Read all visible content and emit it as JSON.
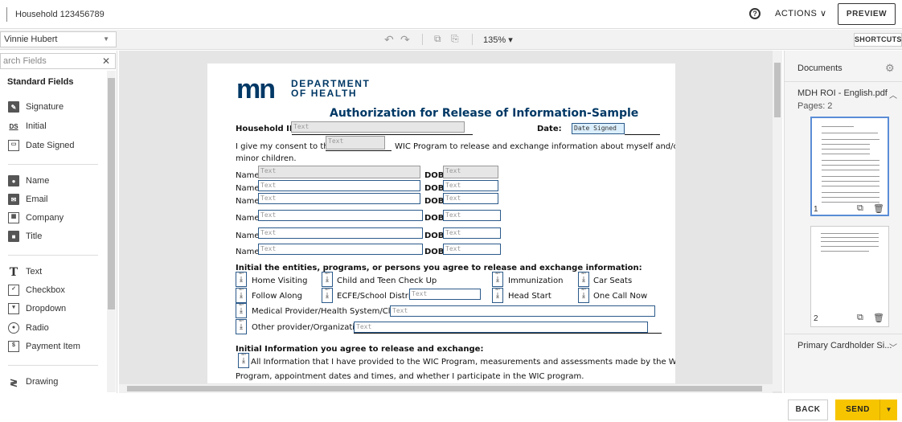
{
  "header": {
    "doc_title": "Household 123456789",
    "help_icon": "?",
    "actions_label": "ACTIONS ∨",
    "preview_label": "PREVIEW"
  },
  "toolbar": {
    "signer": "Vinnie Hubert",
    "zoom": "135% ▾",
    "shortcuts_label": "SHORTCUTS"
  },
  "sidebar": {
    "search_placeholder": "arch Fields",
    "section_title": "Standard Fields",
    "fields": [
      {
        "label": "Signature",
        "icon": "signature-icon"
      },
      {
        "label": "Initial",
        "icon": "initial-icon",
        "glyph": "DS"
      },
      {
        "label": "Date Signed",
        "icon": "calendar-icon"
      },
      {
        "label": "Name",
        "icon": "person-icon"
      },
      {
        "label": "Email",
        "icon": "envelope-icon"
      },
      {
        "label": "Company",
        "icon": "building-icon"
      },
      {
        "label": "Title",
        "icon": "briefcase-icon"
      },
      {
        "label": "Text",
        "icon": "text-icon",
        "glyph": "T"
      },
      {
        "label": "Checkbox",
        "icon": "checkbox-icon"
      },
      {
        "label": "Dropdown",
        "icon": "dropdown-icon"
      },
      {
        "label": "Radio",
        "icon": "radio-icon"
      },
      {
        "label": "Payment Item",
        "icon": "payment-icon"
      },
      {
        "label": "Drawing",
        "icon": "drawing-icon"
      }
    ]
  },
  "document": {
    "logo_text": "mn",
    "dept_line1": "DEPARTMENT",
    "dept_line2": "OF HEALTH",
    "title": "Authorization for Release of Information-Sample",
    "household_label": "Household ID#",
    "date_label": "Date:",
    "date_field": "Date Signed",
    "field_placeholder": "Text",
    "consent_a": "I give my consent to the",
    "consent_b": "WIC Program to release and exchange information about myself and/or my",
    "consent_c": "minor children.",
    "name_label": "Name",
    "dob_label": "DOB",
    "initial_heading": "Initial the entities, programs, or persons you agree to release and exchange information:",
    "options": [
      "Home Visiting",
      "Child and Teen Check Up",
      "Immunization",
      "Car Seats",
      "Follow Along",
      "ECFE/School District",
      "Head Start",
      "One Call Now"
    ],
    "medical_label": "Medical Provider/Health System/Clinic",
    "other_label": "Other provider/Organization",
    "info_heading": "Initial Information you agree to release and exchange:",
    "info_a": "All Information that I have provided to the WIC Program, measurements and assessments made by the WIC",
    "info_b": "Program, appointment dates and times, and whether I participate in the WIC program.",
    "download_glyph": "⤓"
  },
  "right_panel": {
    "heading": "Documents",
    "doc_name": "MDH ROI - English.pdf",
    "pages": "Pages: 2",
    "page1": "1",
    "page2": "2",
    "cardholder": "Primary Cardholder Si..."
  },
  "footer": {
    "back_label": "BACK",
    "send_label": "SEND"
  }
}
